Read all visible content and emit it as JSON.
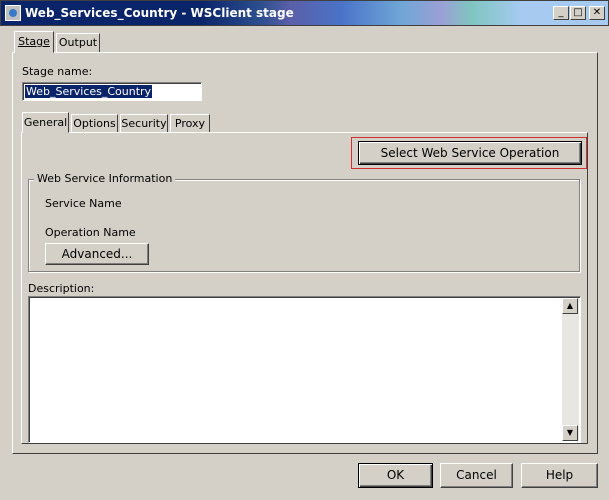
{
  "window": {
    "title_part1": "Web_Services_Country",
    "title_sep": " - ",
    "title_part2": "WSClient stage",
    "minimize": "_",
    "maximize": "□",
    "close": "✕"
  },
  "outer_tabs": [
    {
      "label": "Stage",
      "selected": true
    },
    {
      "label": "Output",
      "selected": false
    }
  ],
  "stage_name": {
    "label": "Stage name:",
    "value": "Web_Services_Country"
  },
  "inner_tabs": [
    {
      "label": "General",
      "selected": true
    },
    {
      "label": "Options",
      "selected": false
    },
    {
      "label": "Security",
      "selected": false
    },
    {
      "label": "Proxy",
      "selected": false
    }
  ],
  "select_operation_button": "Select Web Service Operation",
  "web_service_info": {
    "legend": "Web Service Information",
    "service_name_label": "Service Name",
    "operation_name_label": "Operation Name",
    "advanced_button": "Advanced..."
  },
  "description": {
    "label": "Description:",
    "value": ""
  },
  "footer": {
    "ok": "OK",
    "cancel": "Cancel",
    "help": "Help"
  },
  "colors": {
    "title_bar": "#0a246a",
    "dialog_face": "#d4d0c8",
    "highlight_box": "#d03030"
  }
}
